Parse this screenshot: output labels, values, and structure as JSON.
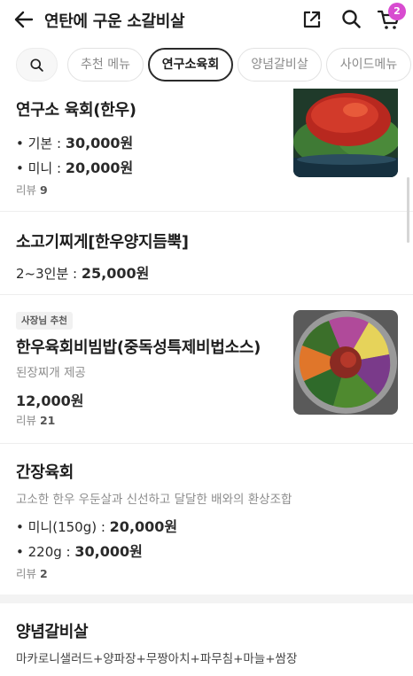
{
  "app_bar": {
    "title": "연탄에 구운 소갈비살",
    "cart_count": "2"
  },
  "chips": [
    {
      "label": "추천 메뉴"
    },
    {
      "label": "연구소육회",
      "active": true
    },
    {
      "label": "양념갈비살"
    },
    {
      "label": "사이드메뉴"
    }
  ],
  "menu": [
    {
      "name": "연구소 육회(한우)",
      "options": [
        {
          "label": "• 기본 : ",
          "price": "30,000원"
        },
        {
          "label": "• 미니 : ",
          "price": "20,000원"
        }
      ],
      "review_label": "리뷰 ",
      "review_count": "9"
    },
    {
      "name": "소고기찌게[한우양지듬뿍]",
      "options": [
        {
          "label": "2~3인분 : ",
          "price": "25,000원"
        }
      ]
    },
    {
      "badge": "사장님 추천",
      "name": "한우육회비빔밥(중독성특제비법소스)",
      "desc": "된장찌개 제공",
      "price": "12,000원",
      "review_label": "리뷰 ",
      "review_count": "21"
    },
    {
      "name": "간장육회",
      "desc": "고소한 한우 우둔살과 신선하고 달달한 배와의 환상조합",
      "options": [
        {
          "label": "• 미니(150g) : ",
          "price": "20,000원"
        },
        {
          "label": "• 220g : ",
          "price": "30,000원"
        }
      ],
      "review_label": "리뷰 ",
      "review_count": "2"
    },
    {
      "name": "양념갈비살",
      "desc": "마카로니샐러드+양파장+무짱아치+파무침+마늘+쌈장"
    }
  ],
  "colors": {
    "badge": "#d84bd0",
    "active_chip_border": "#2a2a2a"
  }
}
